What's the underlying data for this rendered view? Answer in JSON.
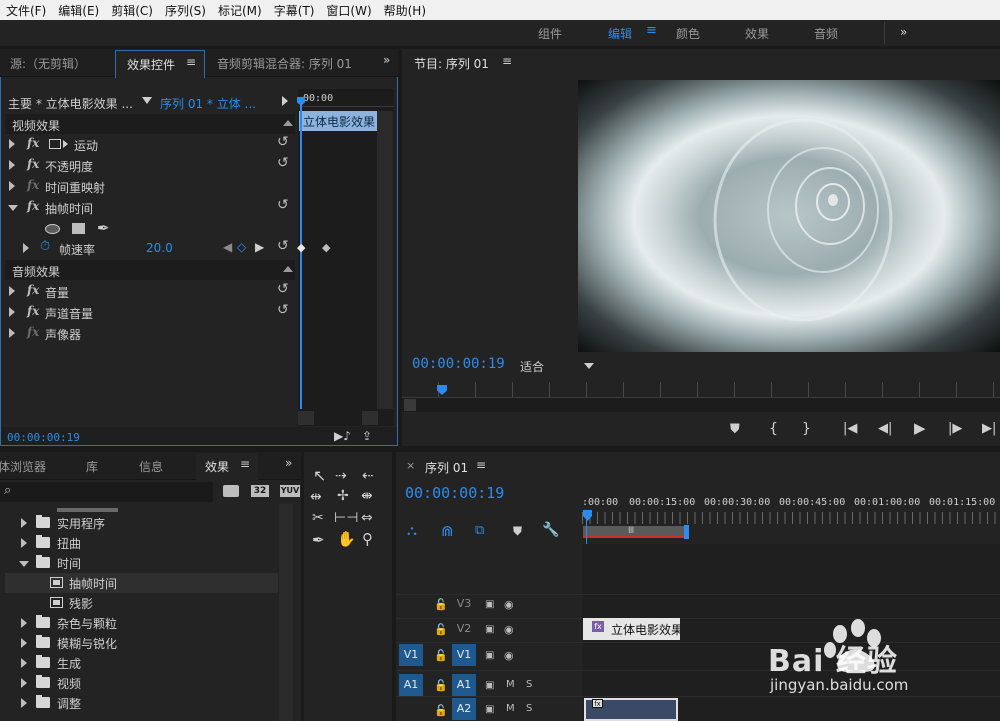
{
  "menu": [
    "文件(F)",
    "编辑(E)",
    "剪辑(C)",
    "序列(S)",
    "标记(M)",
    "字幕(T)",
    "窗口(W)",
    "帮助(H)"
  ],
  "workspaces": [
    {
      "label": "组件",
      "active": false
    },
    {
      "label": "编辑",
      "active": true
    },
    {
      "label": "颜色",
      "active": false
    },
    {
      "label": "效果",
      "active": false
    },
    {
      "label": "音频",
      "active": false
    }
  ],
  "workspace_more": "»",
  "left_panel": {
    "tabs": [
      "源:（无剪辑）",
      "效果控件",
      "音频剪辑混合器: 序列 01"
    ],
    "active_tab": "效果控件",
    "master_label": "主要 * 立体电影效果 ...",
    "sequence_label": "序列 01 * 立体 ...",
    "ruler_time": "00:00",
    "clip_label": "立体电影效果",
    "video_section": "视频效果",
    "audio_section": "音频效果",
    "video_effects": [
      {
        "label": "运动",
        "enabled": true,
        "expanded": false
      },
      {
        "label": "不透明度",
        "enabled": true,
        "expanded": false
      },
      {
        "label": "时间重映射",
        "enabled": false,
        "expanded": false
      },
      {
        "label": "抽帧时间",
        "enabled": true,
        "expanded": true
      }
    ],
    "param": {
      "label": "帧速率",
      "value": "20.0"
    },
    "audio_effects": [
      {
        "label": "音量",
        "enabled": true
      },
      {
        "label": "声道音量",
        "enabled": true
      },
      {
        "label": "声像器",
        "enabled": false
      }
    ],
    "footer_time": "00:00:00:19"
  },
  "program_monitor": {
    "title": "节目: 序列 01",
    "timecode": "00:00:00:19",
    "fit_label": "适合"
  },
  "effects_panel": {
    "tabs": [
      "体浏览器",
      "库",
      "信息",
      "效果"
    ],
    "active_tab": "效果",
    "badges": [
      "32",
      "YUV"
    ],
    "items": [
      {
        "type": "folder",
        "label": "实用程序",
        "expanded": false
      },
      {
        "type": "folder",
        "label": "扭曲",
        "expanded": false
      },
      {
        "type": "folder",
        "label": "时间",
        "expanded": true
      },
      {
        "type": "effect",
        "label": "抽帧时间",
        "selected": true
      },
      {
        "type": "effect",
        "label": "残影",
        "selected": false
      },
      {
        "type": "folder",
        "label": "杂色与颗粒",
        "expanded": false
      },
      {
        "type": "folder",
        "label": "模糊与锐化",
        "expanded": false
      },
      {
        "type": "folder",
        "label": "生成",
        "expanded": false
      },
      {
        "type": "folder",
        "label": "视频",
        "expanded": false
      },
      {
        "type": "folder",
        "label": "调整",
        "expanded": false
      }
    ]
  },
  "timeline": {
    "title": "序列 01",
    "timecode": "00:00:00:19",
    "ruler": [
      ":00:00",
      "00:00:15:00",
      "00:00:30:00",
      "00:00:45:00",
      "00:01:00:00",
      "00:01:15:00"
    ],
    "tracks": [
      {
        "name": "V3",
        "target": "",
        "type": "video"
      },
      {
        "name": "V2",
        "target": "",
        "type": "video"
      },
      {
        "name": "V1",
        "target": "V1",
        "type": "video"
      },
      {
        "name": "A1",
        "target": "A1",
        "type": "audio"
      },
      {
        "name": "A2",
        "target": "",
        "type": "audio"
      }
    ],
    "clip_label": "立体电影效果",
    "mute_label": "M",
    "solo_label": "S"
  },
  "watermark": {
    "brand": "Bai 经验",
    "url": "jingyan.baidu.com"
  },
  "accent": "#2d8ceb"
}
